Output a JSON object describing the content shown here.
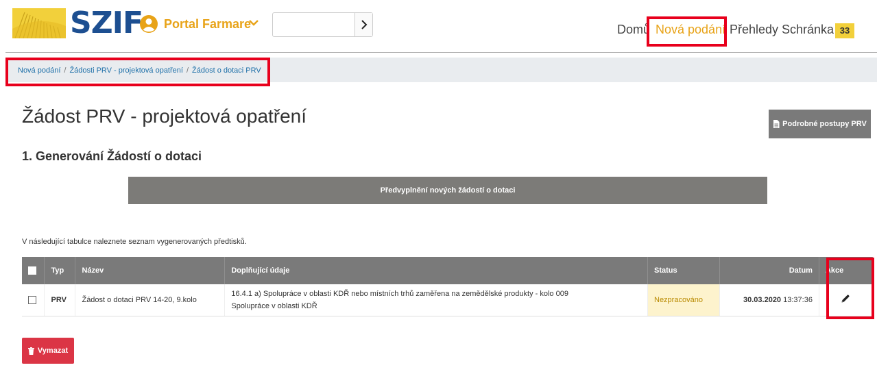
{
  "header": {
    "logo_text": "SZIF",
    "portal_label": "Portal Farmare",
    "search": {
      "value": "",
      "placeholder": ""
    },
    "nav": {
      "home": "Domů",
      "new_submissions": "Nová podání",
      "overviews": "Přehledy",
      "inbox": "Schránka",
      "inbox_count": "33"
    }
  },
  "breadcrumb": {
    "items": [
      "Nová podání",
      "Žádosti PRV - projektová opatření",
      "Žádost o dotaci PRV"
    ],
    "separator": "/"
  },
  "page": {
    "title": "Žádost PRV - projektová opatření",
    "guide_button": "Podrobné postupy PRV",
    "section_title": "1. Generování Žádostí o dotaci",
    "prefill_button": "Předvyplnění nových žádostí o dotaci",
    "intro_text": "V následující tabulce naleznete seznam vygenerovaných předtisků."
  },
  "table": {
    "columns": [
      "Typ",
      "Název",
      "Doplňující údaje",
      "Status",
      "Datum",
      "Akce"
    ],
    "rows": [
      {
        "type": "PRV",
        "name": "Žádost o dotaci PRV 14-20, 9.kolo",
        "details_line1": "16.4.1 a) Spolupráce v oblasti KDŘ nebo místních trhů zaměřena na zemědělské produkty - kolo 009",
        "details_line2": "Spolupráce v oblasti KDŘ",
        "status": "Nezpracováno",
        "date": "30.03.2020",
        "time": "13:37:36"
      }
    ]
  },
  "delete_button": "Vymazat",
  "colors": {
    "brand_blue": "#1d4f91",
    "accent_yellow": "#e8a318",
    "highlight_red": "#e8001c",
    "header_gray": "#7a7a7a",
    "delete_red": "#db3545",
    "status_bg": "#fdf3cd"
  },
  "icons": {
    "logo": "wheat-field-icon",
    "avatar": "user-circle-icon",
    "portal_toggle": "chevron-down-icon",
    "search_go": "chevron-right-icon",
    "guide": "document-icon",
    "edit": "pencil-icon",
    "delete": "trash-icon"
  }
}
